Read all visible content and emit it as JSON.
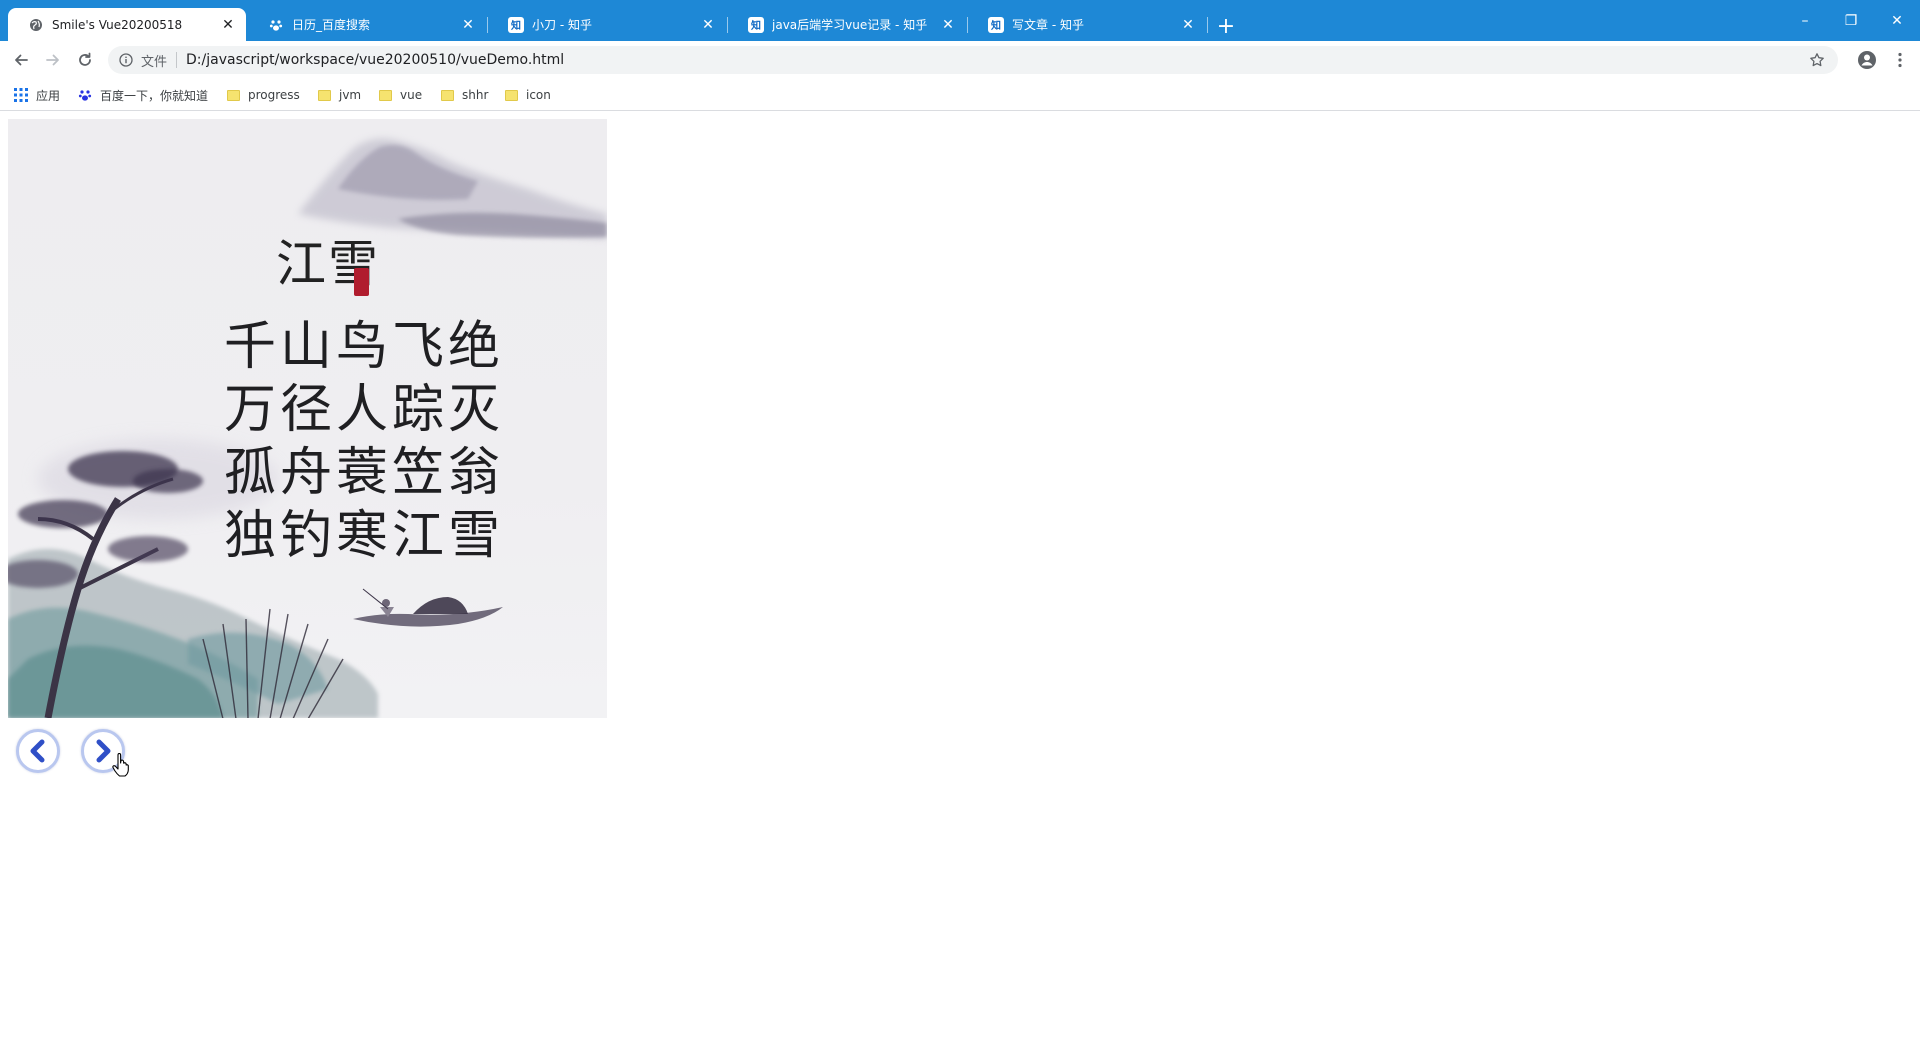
{
  "browser": {
    "tabs": [
      {
        "title": "Smile's Vue20200518",
        "icon": "globe-icon",
        "active": true
      },
      {
        "title": "日历_百度搜索",
        "icon": "baidu-paw-icon",
        "active": false
      },
      {
        "title": "小刀 - 知乎",
        "icon": "zhihu-icon",
        "active": false
      },
      {
        "title": "java后端学习vue记录 - 知乎",
        "icon": "zhihu-icon",
        "active": false
      },
      {
        "title": "写文章 - 知乎",
        "icon": "zhihu-icon",
        "active": false
      }
    ],
    "zhihu_badge": "知",
    "new_tab": "+",
    "window_controls": {
      "minimize": "–",
      "restore": "❐",
      "close": "✕"
    },
    "address": {
      "scheme_label": "文件",
      "url": "D:/javascript/workspace/vue20200510/vueDemo.html"
    },
    "bookmarks": [
      {
        "label": "应用",
        "icon": "apps-grid-icon"
      },
      {
        "label": "百度一下，你就知道",
        "icon": "baidu-paw-icon"
      },
      {
        "label": "progress",
        "icon": "folder-icon"
      },
      {
        "label": "jvm",
        "icon": "folder-icon"
      },
      {
        "label": "vue",
        "icon": "folder-icon"
      },
      {
        "label": "shhr",
        "icon": "folder-icon"
      },
      {
        "label": "icon",
        "icon": "folder-icon"
      }
    ],
    "accent_color": "#1e88d6"
  },
  "page": {
    "image": {
      "title": "江雪",
      "lines": [
        "千山鸟飞绝",
        "万径人踪灭",
        "孤舟蓑笠翁",
        "独钓寒江雪"
      ]
    },
    "controls": {
      "prev_icon": "chevron-left-icon",
      "next_icon": "chevron-right-icon",
      "control_color": "#2f4fc7"
    }
  }
}
